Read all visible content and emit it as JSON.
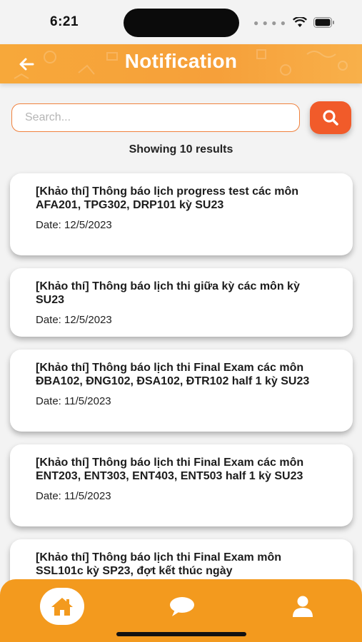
{
  "status_bar": {
    "time": "6:21"
  },
  "header": {
    "title": "Notification"
  },
  "search": {
    "placeholder": "Search..."
  },
  "results": {
    "summary": "Showing 10 results"
  },
  "notifications": [
    {
      "title": "[Khảo thí] Thông báo lịch progress test các môn AFA201, TPG302, DRP101 kỳ SU23",
      "date": "Date: 12/5/2023"
    },
    {
      "title": "[Khảo thí] Thông báo lịch thi giữa kỳ các môn kỳ SU23",
      "date": "Date: 12/5/2023"
    },
    {
      "title": "[Khảo thí] Thông báo lịch thi Final Exam các môn ĐBA102, ĐNG102, ĐSA102, ĐTR102 half 1 kỳ SU23",
      "date": "Date: 11/5/2023"
    },
    {
      "title": "[Khảo thí] Thông báo lịch thi Final Exam các môn ENT203, ENT303, ENT403, ENT503 half 1 kỳ SU23",
      "date": "Date: 11/5/2023"
    },
    {
      "title": "[Khảo thí] Thông báo lịch thi Final Exam môn SSL101c kỳ SP23, đợt kết thúc ngày",
      "date": ""
    }
  ],
  "nav": {
    "items": [
      "home-icon",
      "chat-icon",
      "profile-icon"
    ],
    "active": "home-icon"
  },
  "colors": {
    "accent": "#f39a1e",
    "search_button": "#f15b2a",
    "search_border": "#f0813d"
  }
}
